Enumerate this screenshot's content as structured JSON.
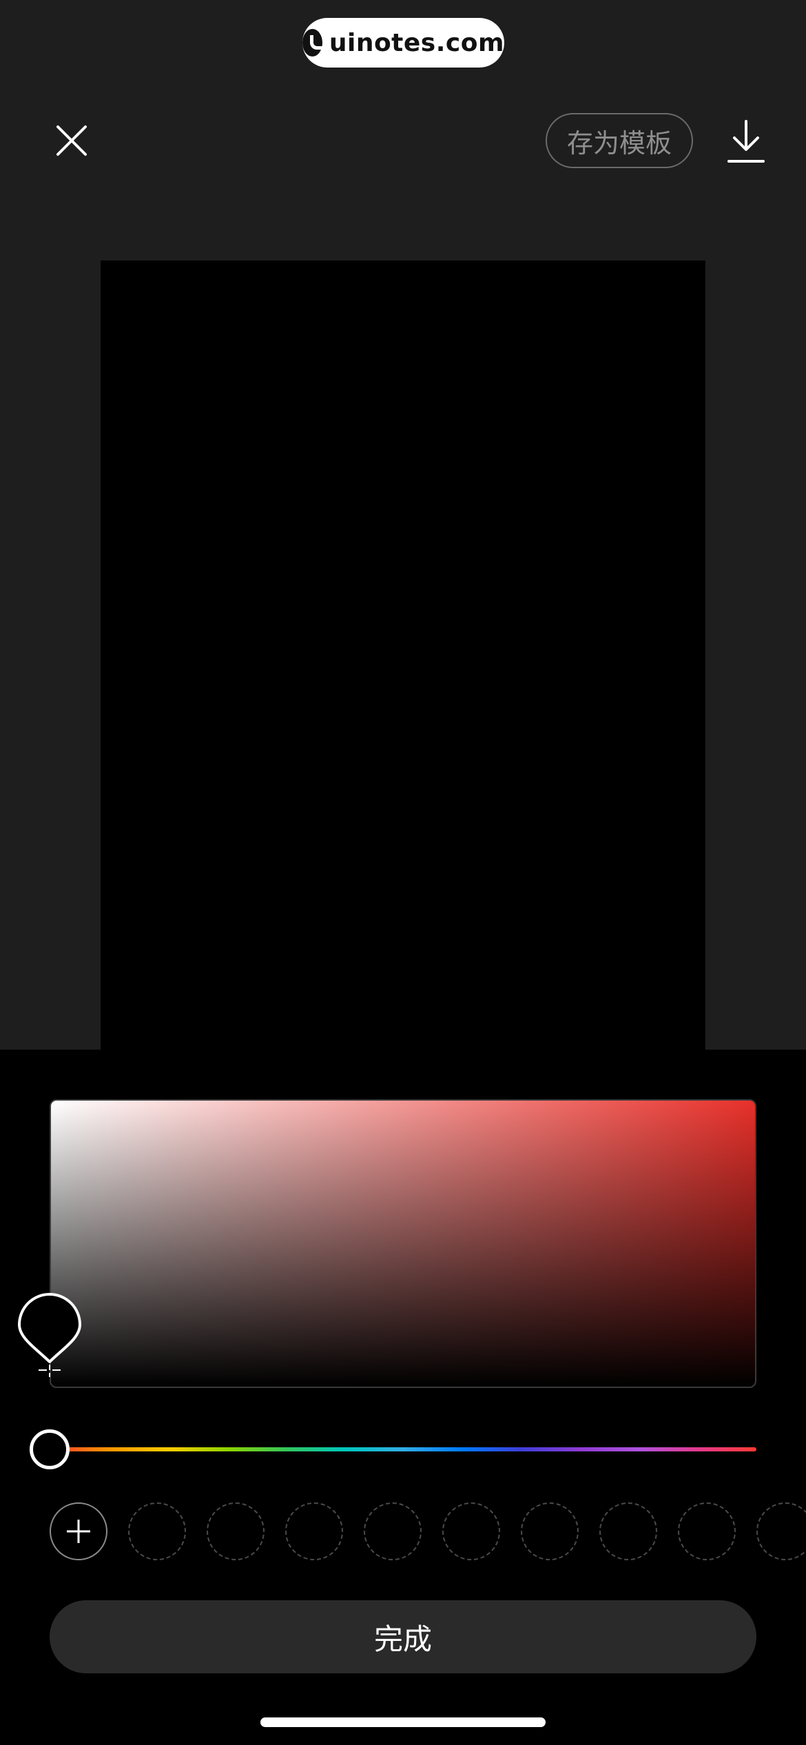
{
  "watermark": {
    "text": "uinotes.com"
  },
  "toolbar": {
    "close_icon": "close-icon",
    "save_template_label": "存为模板",
    "download_icon": "download-icon"
  },
  "color_picker": {
    "base_hue_color": "#e8302a",
    "selected_color": "#000000",
    "saturation": 0,
    "brightness": 0,
    "hue_position": 0,
    "add_swatch_icon": "plus-icon",
    "empty_swatch_count": 9
  },
  "done_label": "完成"
}
